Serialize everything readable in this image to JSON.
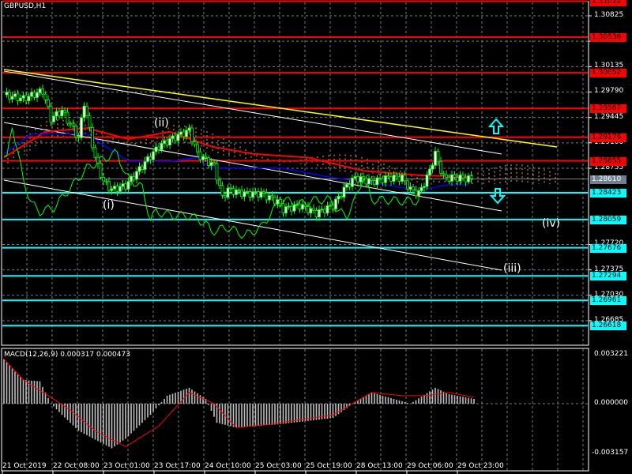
{
  "window": {
    "symbol_title": "GBPUSD,H1"
  },
  "colors": {
    "background": "#000000",
    "grid": "#6f7b8a",
    "bull": "#00ff00",
    "resistance": "#ff0000",
    "support": "#00ffff",
    "trend_yellow": "#ffff00",
    "cloud": "#f4a460",
    "macd_signal": "#ff0000",
    "macd_hist": "#c0c0c0"
  },
  "price_axis": {
    "ticks": [
      "1.30825",
      "1.30480",
      "1.30135",
      "1.29790",
      "1.29445",
      "1.29100",
      "1.28755",
      "1.27720",
      "1.27375",
      "1.27030",
      "1.26685"
    ],
    "current_price": "1.28610",
    "resistance_levels": [
      "1.31022",
      "1.30536",
      "1.30052",
      "1.29567",
      "1.29176",
      "1.28855"
    ],
    "support_levels": [
      "1.28423",
      "1.28059",
      "1.27676",
      "1.27294",
      "1.26961",
      "1.26618"
    ]
  },
  "time_axis": {
    "labels": [
      "21 Oct 2019",
      "22 Oct 08:00",
      "23 Oct 01:00",
      "23 Oct 17:00",
      "24 Oct 10:00",
      "25 Oct 03:00",
      "25 Oct 19:00",
      "28 Oct 13:00",
      "29 Oct 06:00",
      "29 Oct 23:00"
    ]
  },
  "wave_labels": {
    "i": "(i)",
    "ii": "(ii)",
    "iii": "(iii)",
    "iv": "(iv)"
  },
  "signals": {
    "up_arrow": "arrow-up-icon",
    "down_arrow": "arrow-down-icon"
  },
  "macd": {
    "title": "MACD(12,26,9) 0.000317 0.000473",
    "axis_max": "0.003221",
    "axis_zero": "0.000000",
    "axis_min": "-0.003157"
  },
  "chart_data": {
    "type": "line",
    "title": "GBPUSD,H1",
    "ylim": [
      1.2645,
      1.3115
    ],
    "price_path": [
      [
        0,
        1.29752
      ],
      [
        7,
        1.29699
      ],
      [
        14,
        1.29806
      ],
      [
        17,
        1.29431
      ],
      [
        21,
        1.29538
      ],
      [
        27,
        1.29162
      ],
      [
        29,
        1.29645
      ],
      [
        33,
        1.28894
      ],
      [
        36,
        1.28573
      ],
      [
        39,
        1.28465
      ],
      [
        44,
        1.28519
      ],
      [
        50,
        1.28787
      ],
      [
        56,
        1.29055
      ],
      [
        61,
        1.29162
      ],
      [
        67,
        1.2927
      ],
      [
        70,
        1.28948
      ],
      [
        76,
        1.28787
      ],
      [
        79,
        1.28358
      ],
      [
        81,
        1.28465
      ],
      [
        87,
        1.28412
      ],
      [
        93,
        1.28412
      ],
      [
        99,
        1.28304
      ],
      [
        101,
        1.28197
      ],
      [
        107,
        1.28251
      ],
      [
        113,
        1.28143
      ],
      [
        119,
        1.28251
      ],
      [
        124,
        1.28519
      ],
      [
        127,
        1.28626
      ],
      [
        133,
        1.28573
      ],
      [
        139,
        1.28626
      ],
      [
        144,
        1.28626
      ],
      [
        147,
        1.28465
      ],
      [
        150,
        1.28412
      ],
      [
        153,
        1.28626
      ],
      [
        156,
        1.28948
      ],
      [
        159,
        1.28626
      ],
      [
        164,
        1.28626
      ],
      [
        169,
        1.2861
      ]
    ],
    "ma_red": [
      [
        0,
        1.289
      ],
      [
        15,
        1.2925
      ],
      [
        30,
        1.293
      ],
      [
        45,
        1.2915
      ],
      [
        60,
        1.2925
      ],
      [
        75,
        1.2905
      ],
      [
        90,
        1.2895
      ],
      [
        110,
        1.289
      ],
      [
        130,
        1.2872
      ],
      [
        150,
        1.2866
      ],
      [
        168,
        1.2864
      ]
    ],
    "kijun_blue": [
      [
        0,
        1.2895
      ],
      [
        10,
        1.2922
      ],
      [
        30,
        1.2922
      ],
      [
        45,
        1.2885
      ],
      [
        60,
        1.2885
      ],
      [
        70,
        1.289
      ],
      [
        75,
        1.2876
      ],
      [
        100,
        1.2876
      ],
      [
        120,
        1.2862
      ],
      [
        140,
        1.2852
      ],
      [
        150,
        1.2845
      ],
      [
        160,
        1.2853
      ],
      [
        168,
        1.2853
      ]
    ],
    "macd_hist": [
      [
        0,
        0.0028
      ],
      [
        4,
        0.002
      ],
      [
        7,
        0.0015
      ],
      [
        13,
        0.0014
      ],
      [
        17,
        0.0
      ],
      [
        21,
        -0.0007
      ],
      [
        27,
        -0.0017
      ],
      [
        39,
        -0.0028
      ],
      [
        44,
        -0.0022
      ],
      [
        53,
        -0.0007
      ],
      [
        59,
        0.0005
      ],
      [
        67,
        0.001
      ],
      [
        73,
        0.0003
      ],
      [
        77,
        -0.0012
      ],
      [
        84,
        -0.0015
      ],
      [
        99,
        -0.0013
      ],
      [
        119,
        -0.0009
      ],
      [
        127,
        0.0001
      ],
      [
        133,
        0.0007
      ],
      [
        141,
        0.0003
      ],
      [
        147,
        0.0
      ],
      [
        156,
        0.001
      ],
      [
        161,
        0.0006
      ],
      [
        170,
        0.0003
      ]
    ],
    "macd_signal": [
      [
        0,
        0.0028
      ],
      [
        7,
        0.0015
      ],
      [
        16,
        0.0005
      ],
      [
        24,
        -0.0004
      ],
      [
        33,
        -0.0017
      ],
      [
        44,
        -0.0027
      ],
      [
        56,
        -0.0014
      ],
      [
        67,
        0.0007
      ],
      [
        76,
        0.0
      ],
      [
        84,
        -0.0015
      ],
      [
        96,
        -0.0013
      ],
      [
        119,
        -0.0007
      ],
      [
        133,
        0.0007
      ],
      [
        144,
        0.0005
      ],
      [
        153,
        0.0005
      ],
      [
        161,
        0.0007
      ],
      [
        170,
        0.0004
      ]
    ]
  }
}
